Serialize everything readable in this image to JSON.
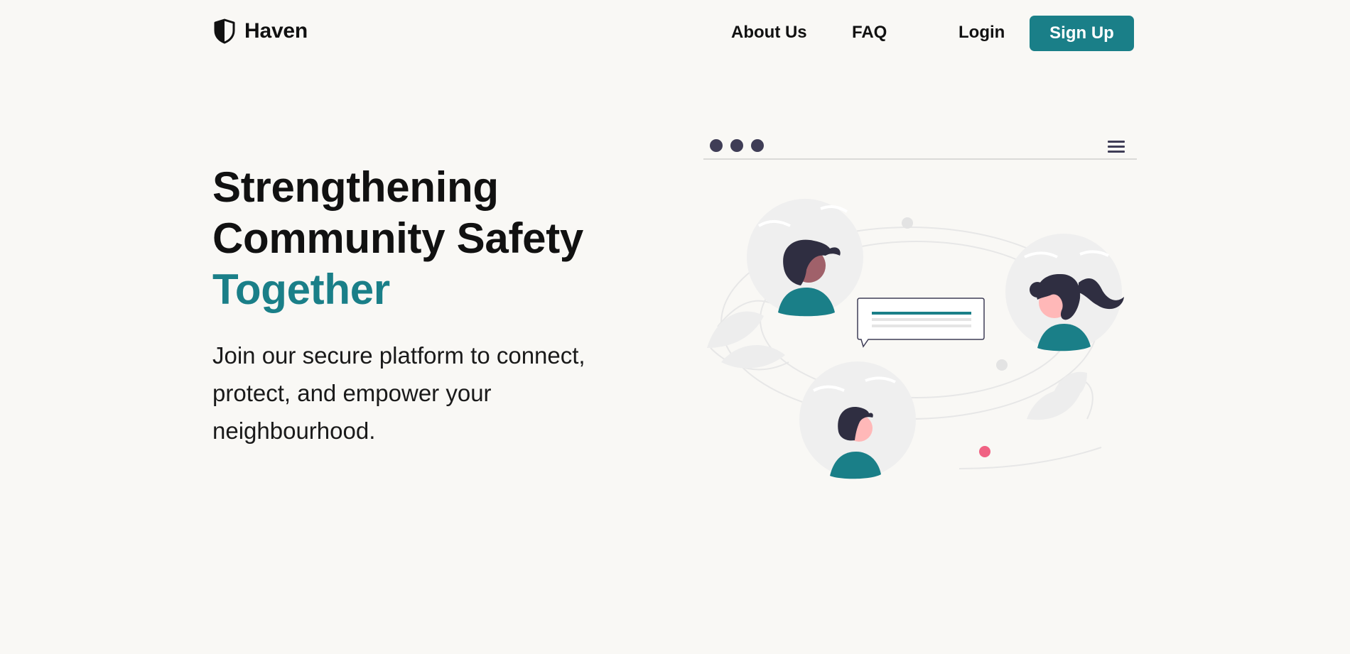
{
  "brand": {
    "name": "Haven",
    "logo_icon": "shield-icon"
  },
  "nav": {
    "about_label": "About Us",
    "faq_label": "FAQ",
    "login_label": "Login",
    "signup_label": "Sign Up"
  },
  "hero": {
    "title_line1": "Strengthening",
    "title_line2": "Community Safety",
    "title_line3": "Together",
    "subtitle": "Join our secure platform to connect, protect, and empower your neighbourhood."
  },
  "illustration": {
    "window_icon": "browser-window-icon",
    "menu_icon": "hamburger-menu-icon",
    "avatars": [
      "person-avatar",
      "person-avatar",
      "person-avatar"
    ],
    "chat_icon": "chat-bubble-icon"
  },
  "colors": {
    "accent": "#1a7f88",
    "background": "#f9f8f5",
    "text": "#111111",
    "dark_figure": "#2f2e41",
    "highlight_dot": "#f06283"
  }
}
